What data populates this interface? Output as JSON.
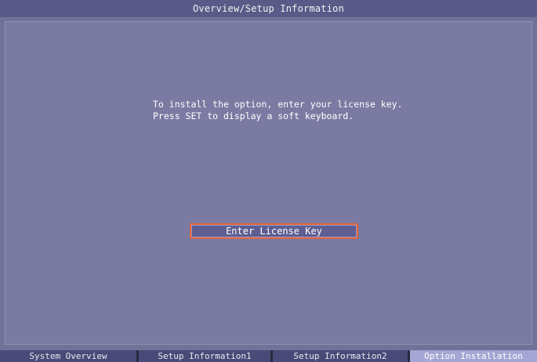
{
  "header": {
    "title": "Overview/Setup Information"
  },
  "main": {
    "message_line1": "To install the option, enter your license key.",
    "message_line2": "Press SET to display a soft keyboard.",
    "enter_button_label": "Enter License Key"
  },
  "tabs": [
    {
      "label": "System Overview",
      "active": false
    },
    {
      "label": "Setup Information1",
      "active": false
    },
    {
      "label": "Setup Information2",
      "active": false
    },
    {
      "label": "Option Installation",
      "active": true
    }
  ],
  "colors": {
    "background": "#727299",
    "panel": "#7a7aa2",
    "button_border": "#e8643a",
    "active_tab": "#a6a6d4"
  }
}
